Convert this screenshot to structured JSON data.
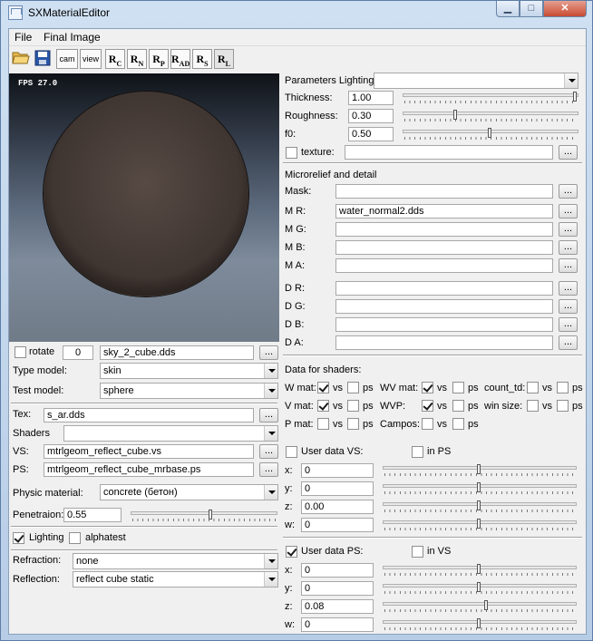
{
  "window": {
    "title": "SXMaterialEditor",
    "minimize": "▁",
    "maximize": "□",
    "close": "✕"
  },
  "menu": {
    "file": "File",
    "final_image": "Final Image"
  },
  "toolbar": {
    "cam": "cam",
    "view": "view",
    "rc_r": "R",
    "rc_s": "C",
    "rn_r": "R",
    "rn_s": "N",
    "rp_r": "R",
    "rp_s": "P",
    "rad_r": "R",
    "rad_s": "AD",
    "rs_r": "R",
    "rs_s": "S",
    "rl_r": "R",
    "rl_s": "L"
  },
  "preview": {
    "fps": "FPS 27.0"
  },
  "left": {
    "rotate_label": "rotate",
    "rotate_value": "0",
    "skybox": "sky_2_cube.dds",
    "browse": "...",
    "type_model_label": "Type model:",
    "type_model_value": "skin",
    "test_model_label": "Test model:",
    "test_model_value": "sphere",
    "tex_label": "Tex:",
    "tex_value": "s_ar.dds",
    "shaders_label": "Shaders",
    "shaders_value": "",
    "vs_label": "VS:",
    "vs_value": "mtrlgeom_reflect_cube.vs",
    "ps_label": "PS:",
    "ps_value": "mtrlgeom_reflect_cube_mrbase.ps",
    "physic_label": "Physic material:",
    "physic_value": "concrete (бетон)",
    "penetration_label": "Penetraion:",
    "penetration_value": "0.55",
    "penetration_level": 0.55,
    "lighting_label": "Lighting",
    "lighting_checked": true,
    "alphatest_label": "alphatest",
    "alphatest_checked": false,
    "refraction_label": "Refraction:",
    "refraction_value": "none",
    "reflection_label": "Reflection:",
    "reflection_value": "reflect cube static"
  },
  "right": {
    "params_label": "Parameters Lighting:",
    "params_value": "",
    "thickness_label": "Thickness:",
    "thickness_value": "1.00",
    "thickness_level": 1.0,
    "roughness_label": "Roughness:",
    "roughness_value": "0.30",
    "roughness_level": 0.3,
    "f0_label": "f0:",
    "f0_value": "0.50",
    "f0_level": 0.5,
    "texture_label": "texture:",
    "texture_value": "",
    "micro_header": "Microrelief and detail",
    "mask_label": "Mask:",
    "mask_value": "",
    "mr_label": "M R:",
    "mr_value": "water_normal2.dds",
    "mg_label": "M G:",
    "mg_value": "",
    "mb_label": "M B:",
    "mb_value": "",
    "ma_label": "M A:",
    "ma_value": "",
    "dr_label": "D R:",
    "dr_value": "",
    "dg_label": "D G:",
    "dg_value": "",
    "db_label": "D B:",
    "db_value": "",
    "da_label": "D A:",
    "da_value": "",
    "shaders_data_header": "Data for shaders:",
    "wmat": "W mat:",
    "vmat": "V mat:",
    "pmat": "P mat:",
    "wvmat": "WV mat:",
    "wvp": "WVP:",
    "campos": "Campos:",
    "count_td": "count_td:",
    "win_size": "win size:",
    "vs": "vs",
    "ps": "ps",
    "user_vs_label": "User data VS:",
    "in_ps_label": "in PS",
    "user_ps_label": "User data PS:",
    "in_vs_label": "in VS",
    "x": "x:",
    "y": "y:",
    "z": "z:",
    "w": "w:",
    "uvs": [
      "0",
      "0",
      "0.00",
      "0"
    ],
    "uvs_levels": [
      0.5,
      0.5,
      0.5,
      0.5
    ],
    "ups": [
      "0",
      "0",
      "0.08",
      "0"
    ],
    "ups_levels": [
      0.5,
      0.5,
      0.54,
      0.5
    ]
  }
}
